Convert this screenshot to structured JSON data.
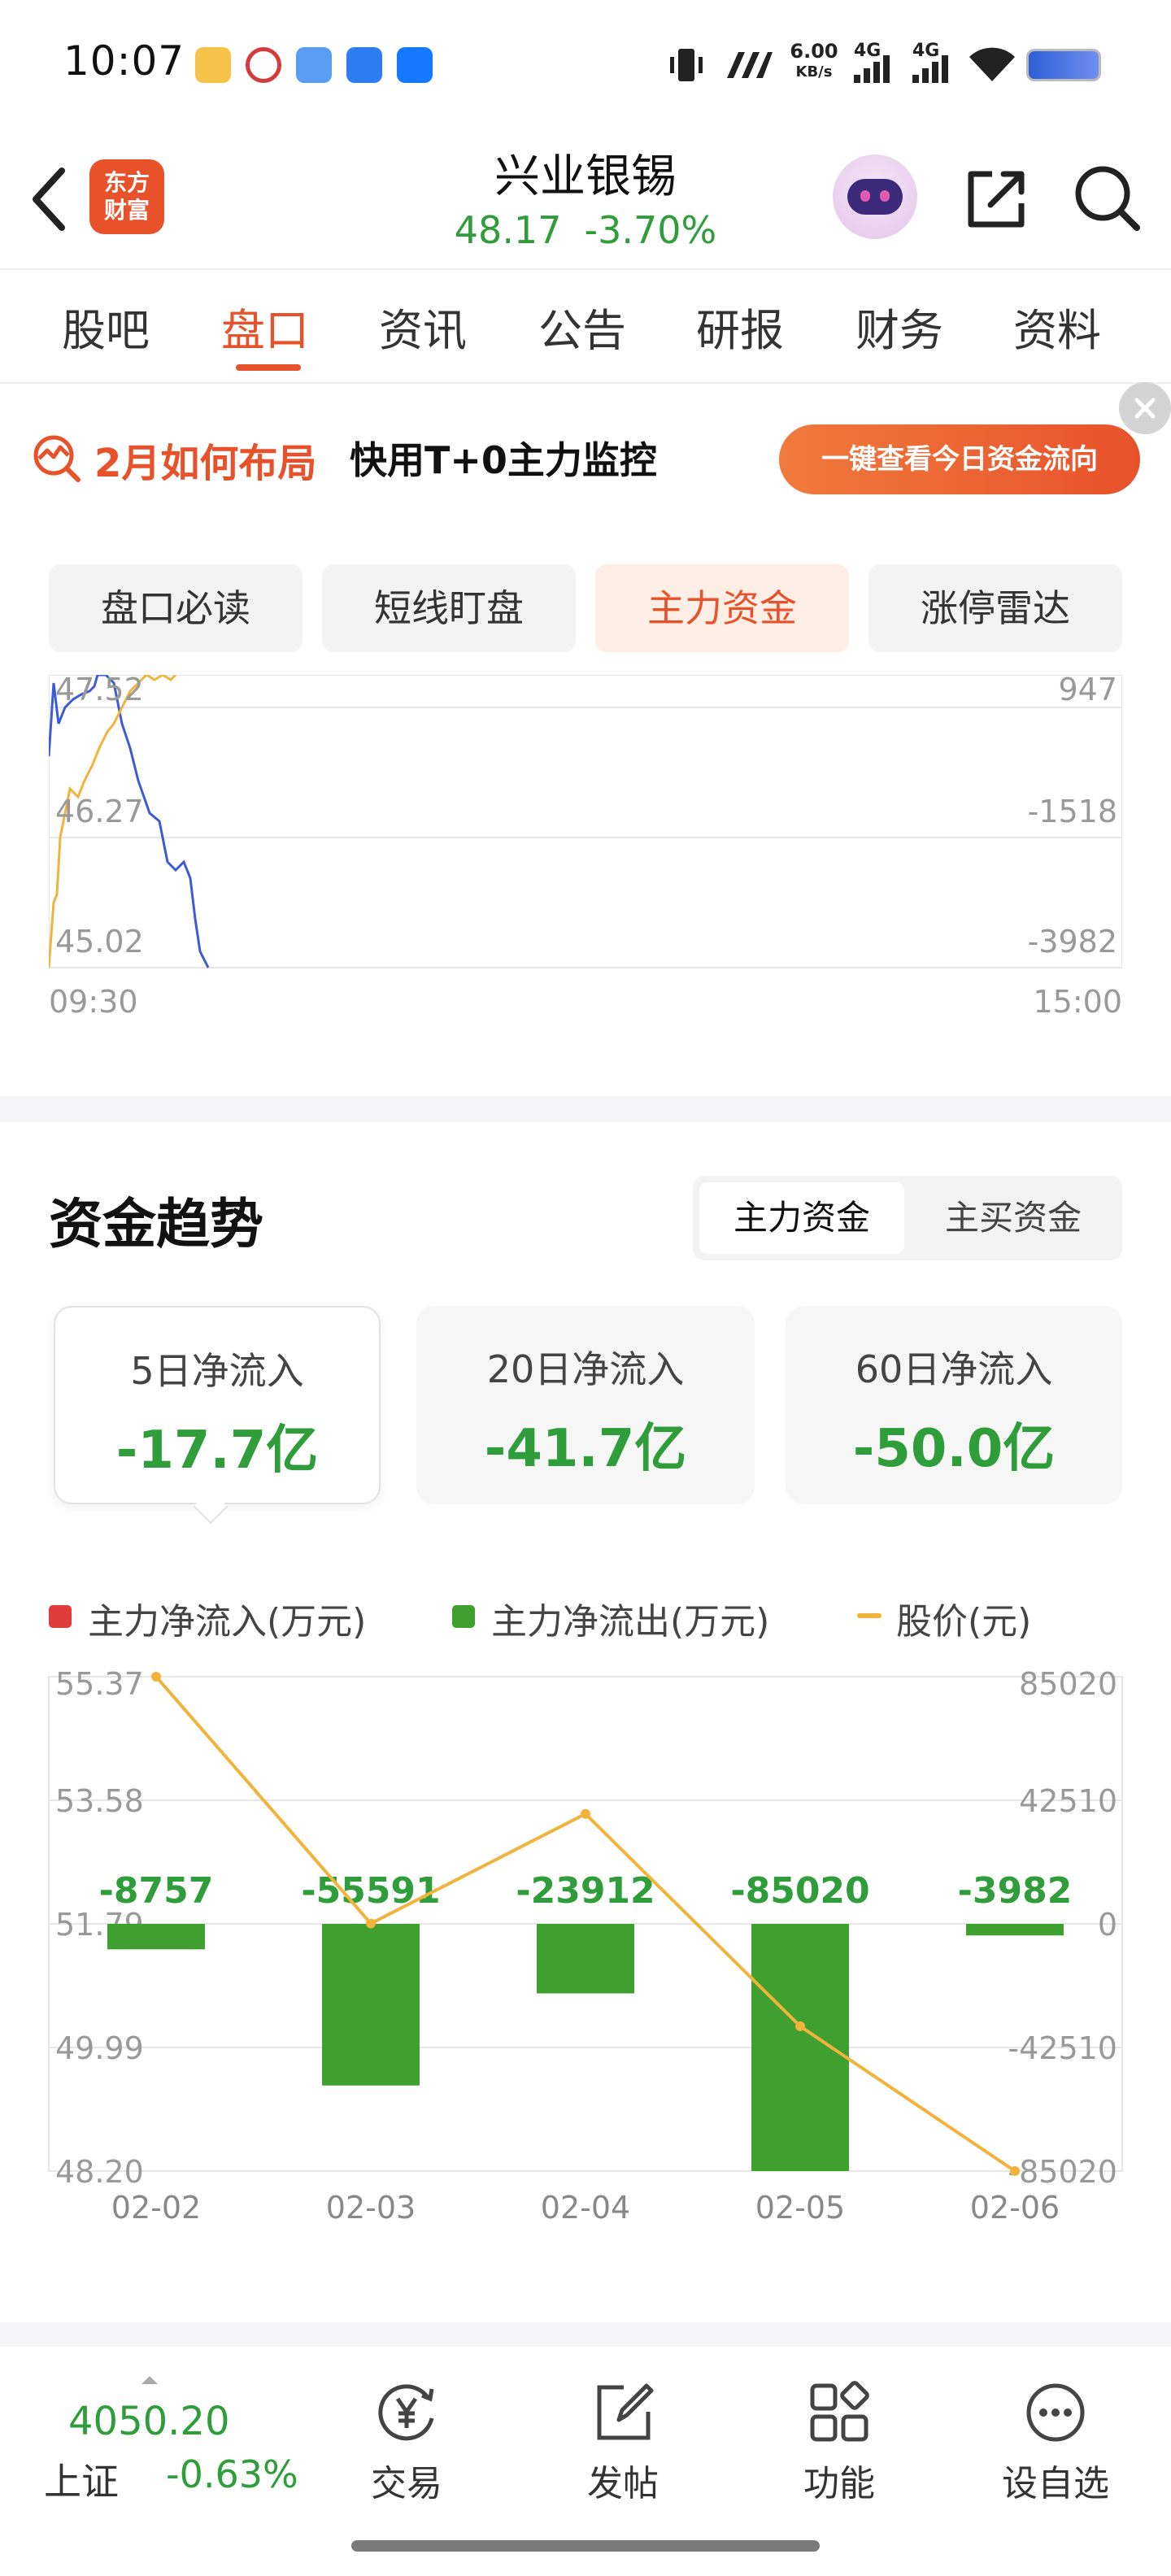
{
  "status_bar": {
    "time": "10:07",
    "net_speed_top": "6.00",
    "net_speed_unit": "KB/s",
    "signal_1": "4G",
    "signal_2": "4G",
    "app_icons": [
      "weibo-icon",
      "metro-icon",
      "cloud-icon",
      "feather-icon",
      "alipay-icon"
    ]
  },
  "header": {
    "logo_line1": "东方",
    "logo_line2": "财富",
    "stock_name": "兴业银锡",
    "price": "48.17",
    "change_pct": "-3.70%"
  },
  "main_tabs": [
    {
      "label": "股吧",
      "active": false
    },
    {
      "label": "盘口",
      "active": true
    },
    {
      "label": "资讯",
      "active": false
    },
    {
      "label": "公告",
      "active": false
    },
    {
      "label": "研报",
      "active": false
    },
    {
      "label": "财务",
      "active": false
    },
    {
      "label": "资料",
      "active": false
    }
  ],
  "promo": {
    "title": "2月如何布局",
    "subtitle": "快用T+0主力监控",
    "button": "一键查看今日资金流向"
  },
  "sub_tabs": [
    {
      "label": "盘口必读",
      "active": false
    },
    {
      "label": "短线盯盘",
      "active": false
    },
    {
      "label": "主力资金",
      "active": true
    },
    {
      "label": "涨停雷达",
      "active": false
    }
  ],
  "intraday": {
    "left_ticks": [
      "47.52",
      "46.27",
      "45.02"
    ],
    "right_ticks": [
      "947",
      "-1518",
      "-3982"
    ],
    "time_start": "09:30",
    "time_end": "15:00"
  },
  "trend": {
    "title": "资金趋势",
    "toggle": [
      {
        "label": "主力资金",
        "active": true
      },
      {
        "label": "主买资金",
        "active": false
      }
    ],
    "cards": [
      {
        "label": "5日净流入",
        "value": "-17.7亿",
        "active": true
      },
      {
        "label": "20日净流入",
        "value": "-41.7亿",
        "active": false
      },
      {
        "label": "60日净流入",
        "value": "-50.0亿",
        "active": false
      }
    ],
    "legend": [
      {
        "label": "主力净流入(万元)",
        "color": "#e03c3c"
      },
      {
        "label": "主力净流出(万元)",
        "color": "#3f9f2f"
      },
      {
        "label": "股价(元)",
        "color": "#f0b43c"
      }
    ]
  },
  "chart_data": {
    "type": "bar",
    "categories": [
      "02-02",
      "02-03",
      "02-04",
      "02-05",
      "02-06"
    ],
    "series": [
      {
        "name": "主力净流出(万元)",
        "type": "bar",
        "axis": "right",
        "values": [
          -8757,
          -55591,
          -23912,
          -85020,
          -3982
        ],
        "labels": [
          "-8757",
          "-55591",
          "-23912",
          "-85020",
          "-3982"
        ]
      },
      {
        "name": "股价(元)",
        "type": "line",
        "axis": "left",
        "values": [
          55.37,
          51.79,
          53.38,
          50.3,
          48.2
        ]
      }
    ],
    "left_ticks": [
      "55.37",
      "53.58",
      "51.79",
      "49.99",
      "48.20"
    ],
    "left_range": [
      48.2,
      55.37
    ],
    "right_ticks": [
      "85020",
      "42510",
      "0",
      "-42510",
      "-85020"
    ],
    "right_range": [
      -85020,
      85020
    ],
    "grid": true
  },
  "bottom_bar": {
    "index_value": "4050.20",
    "index_name": "上证",
    "index_change": "-0.63%",
    "nav": [
      {
        "label": "交易",
        "icon": "yen-cycle-icon"
      },
      {
        "label": "发帖",
        "icon": "edit-icon"
      },
      {
        "label": "功能",
        "icon": "grid-icon"
      },
      {
        "label": "设自选",
        "icon": "more-dots-icon"
      }
    ]
  }
}
